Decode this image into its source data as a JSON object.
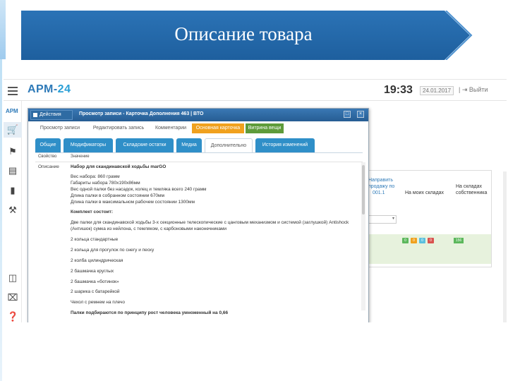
{
  "slide": {
    "title": "Описание товара"
  },
  "app": {
    "logo_prefix": "АРМ-",
    "logo_number": "24",
    "time": "19:33",
    "date": "24.01.2017",
    "exit": "| ⇥ Выйти"
  },
  "sidebar": {
    "label": "АРМ",
    "icons": [
      "cart-icon",
      "tags-icon",
      "list-icon",
      "document-icon",
      "wrench-icon",
      "monitors-icon",
      "close-box-icon",
      "help-icon"
    ]
  },
  "background_panel": {
    "col1": [
      "Направить",
      "продажу по",
      "001.1"
    ],
    "col2": "На моих складах",
    "col3": [
      "На складах",
      "собственника"
    ],
    "select": "▾",
    "chips": [
      {
        "color": "#5cb85c",
        "text": "0"
      },
      {
        "color": "#f0a11e",
        "text": "0"
      },
      {
        "color": "#5bc0de",
        "text": "0"
      },
      {
        "color": "#d9534f",
        "text": "0"
      }
    ],
    "chip_big": "156"
  },
  "modal": {
    "action_label": "Действия",
    "caption": "Просмотр записи - Карточка Дополнения 463 | ВТО",
    "subtabs": [
      "Просмотр записи",
      "Редактировать запись",
      "Комментарии",
      "Основная карточка",
      "Витрина вещи"
    ],
    "tabs": [
      "Общие",
      "Модификаторы",
      "Складские остатки",
      "Медиа",
      "Дополнительно",
      "История изменений"
    ],
    "content": {
      "col_property": "Свойство",
      "col_value": "Значение",
      "label": "Описание",
      "lines": [
        {
          "text": "Набор для скандинавской ходьбы marGO",
          "bold": true
        },
        {
          "text": "Вес набора: 860 грамм",
          "bold": false
        },
        {
          "text": "Габариты набора 780x190x86мм",
          "bold": false
        },
        {
          "text": "Вес одной палки без насадок, колец и темляка всего 240 грамм",
          "bold": false
        },
        {
          "text": "Длина палки в собранном состоянии 670мм",
          "bold": false
        },
        {
          "text": "Длина палки в максимальном рабочем состоянии 1300мм",
          "bold": false
        },
        {
          "text": "Комплект состоит:",
          "bold": true
        },
        {
          "text": "Две палки для скандинавской ходьбы 3-х секционные телескопические с цанговым механизмом и системой (заглушкой) Antishock",
          "bold": false
        },
        {
          "text": "(Антишок) сумка из нейлона, с темляком, с карбоновыми наконечниками",
          "bold": false
        },
        {
          "text": "2 кольца стандартные",
          "bold": false
        },
        {
          "text": "2 кольца для прогулок по снегу и песку",
          "bold": false
        },
        {
          "text": "2 колба цилиндрическая",
          "bold": false
        },
        {
          "text": "2 башмачка круглых",
          "bold": false
        },
        {
          "text": "2 башмачка «ботинок»",
          "bold": false
        },
        {
          "text": "2 шарика с батарейкой",
          "bold": false
        },
        {
          "text": "Чехол с ремнем на плечо",
          "bold": false
        },
        {
          "text": "Палки подбираются по принципу рост человека умноженный на 0,66",
          "bold": true
        }
      ]
    }
  }
}
